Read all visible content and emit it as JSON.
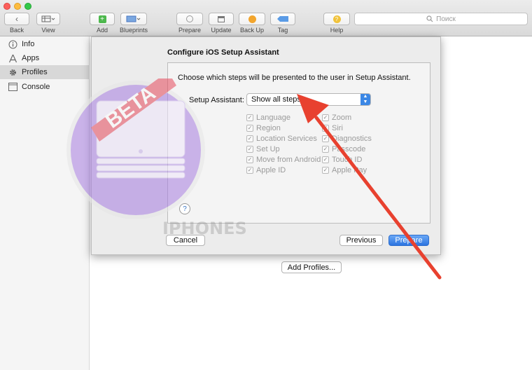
{
  "toolbar": {
    "back_label": "Back",
    "view_label": "View",
    "add_label": "Add",
    "blueprints_label": "Blueprints",
    "prepare_label": "Prepare",
    "update_label": "Update",
    "backup_label": "Back Up",
    "tag_label": "Tag",
    "help_label": "Help",
    "search_placeholder": "Поиск"
  },
  "sidebar": {
    "items": [
      {
        "label": "Info",
        "icon": "info-icon"
      },
      {
        "label": "Apps",
        "icon": "apps-icon"
      },
      {
        "label": "Profiles",
        "icon": "gear-icon",
        "selected": true
      },
      {
        "label": "Console",
        "icon": "console-icon"
      }
    ]
  },
  "dialog": {
    "title": "Configure iOS Setup Assistant",
    "description": "Choose which steps will be presented to the user in Setup Assistant.",
    "setup_label": "Setup Assistant:",
    "setup_value": "Show all steps",
    "steps_left": [
      "Language",
      "Region",
      "Location Services",
      "Set Up",
      "Move from Android",
      "Apple ID"
    ],
    "steps_right": [
      "Zoom",
      "Siri",
      "Diagnostics",
      "Passcode",
      "Touch ID",
      "Apple Pay"
    ],
    "cancel_label": "Cancel",
    "previous_label": "Previous",
    "prepare_label": "Prepare"
  },
  "main": {
    "add_profiles_label": "Add Profiles..."
  },
  "logo": {
    "badge_text": "BETA"
  },
  "watermark": "IPHONES",
  "colors": {
    "accent": "#2c74e0",
    "arrow": "#e8412f",
    "logo_purple": "#a77de0"
  }
}
